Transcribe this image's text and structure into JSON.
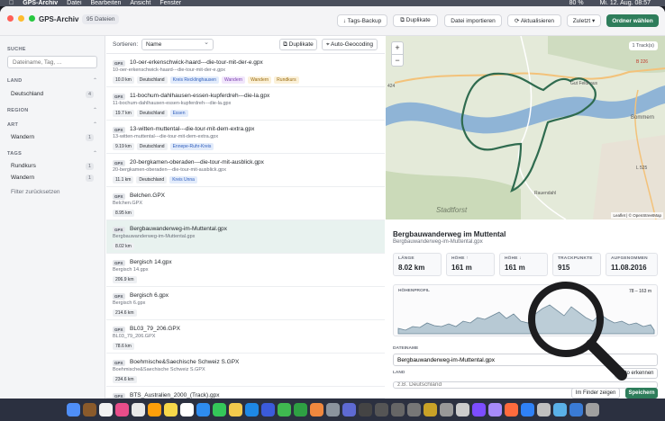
{
  "menubar": {
    "app": "GPS-Archiv",
    "items": [
      "Datei",
      "Bearbeiten",
      "Ansicht",
      "Fenster"
    ],
    "battery": "80 %",
    "datetime": "Mi. 12. Aug. 08:57"
  },
  "titlebar": {
    "title": "GPS-Archiv",
    "count": "95 Dateien",
    "buttons": {
      "tags_backup": "↓ Tags-Backup",
      "duplicates": "⧉ Duplikate",
      "import": "Datei importieren",
      "refresh": "⟳ Aktualisieren",
      "recent": "Zuletzt ▾",
      "choose_folder": "Ordner wählen"
    }
  },
  "sidebar": {
    "search_head": "SUCHE",
    "search_placeholder": "Dateiname, Tag, ...",
    "land_head": "LAND",
    "land_items": [
      {
        "label": "Deutschland",
        "count": "4"
      }
    ],
    "region_head": "REGION",
    "art_head": "ART",
    "art_items": [
      {
        "label": "Wandern",
        "count": "1"
      }
    ],
    "tags_head": "TAGS",
    "tag_items": [
      {
        "label": "Rundkurs",
        "count": "1"
      },
      {
        "label": "Wandern",
        "count": "1"
      }
    ],
    "reset": "Filter zurücksetzen"
  },
  "list": {
    "sort_label": "Sortieren:",
    "sort_value": "Name",
    "duplicates_btn": "⧉ Duplikate",
    "geocode_btn": "⌖ Auto-Geocoding",
    "gpx_badge": "GPX",
    "rows": [
      {
        "title": "10-oer-erkenschwick-haard---die-tour-mit-der-e.gpx",
        "sub": "10-oer-erkenschwick-haard---die-tour-mit-der-e.gpx",
        "tags": [
          "10.0 km",
          "Deutschland",
          "Kreis Recklinghausen",
          "Wandern",
          "Wandern",
          "Rundkurs"
        ]
      },
      {
        "title": "11-bochum-dahlhausen-essen-kupferdreh---die-la.gpx",
        "sub": "11-bochum-dahlhausen-essen-kupferdreh---die-la.gpx",
        "tags": [
          "19.7 km",
          "Deutschland",
          "Essen"
        ]
      },
      {
        "title": "13-witten-muttental---die-tour-mit-dem-extra.gpx",
        "sub": "13-witten-muttental---die-tour-mit-dem-extra.gpx",
        "tags": [
          "9.19 km",
          "Deutschland",
          "Ennepe-Ruhr-Kreis"
        ]
      },
      {
        "title": "20-bergkamen-oberaden---die-tour-mit-ausblick.gpx",
        "sub": "20-bergkamen-oberaden---die-tour-mit-ausblick.gpx",
        "tags": [
          "11.1 km",
          "Deutschland",
          "Kreis Unna"
        ]
      },
      {
        "title": "Belchen.GPX",
        "sub": "Belchen.GPX",
        "tags": [
          "8.95 km"
        ]
      },
      {
        "title": "Bergbauwanderweg-im-Muttental.gpx",
        "sub": "Bergbauwanderweg-im-Muttental.gpx",
        "tags": [
          "8.02 km"
        ]
      },
      {
        "title": "Bergisch 14.gpx",
        "sub": "Bergisch 14.gpx",
        "tags": [
          "206.9 km"
        ]
      },
      {
        "title": "Bergisch 6.gpx",
        "sub": "Bergisch 6.gpx",
        "tags": [
          "214.6 km"
        ]
      },
      {
        "title": "BL03_79_206.GPX",
        "sub": "BL03_79_206.GPX",
        "tags": [
          "78.6 km"
        ]
      },
      {
        "title": "Boehmische&Saechische Schweiz S.GPX",
        "sub": "Boehmische&Saechische Schweiz S.GPX",
        "tags": [
          "234.6 km"
        ]
      },
      {
        "title": "BTS_Australien_2000_(Track).gpx",
        "sub": "",
        "tags": []
      }
    ]
  },
  "map": {
    "zoom_in": "+",
    "zoom_out": "−",
    "track_count": "1 Track(s)",
    "attribution": "Leaflet | © OpenStreetMap",
    "labels": [
      "Stadtforst",
      "Bommern",
      "Rauendahl",
      "Gut Feldhaus",
      "Witten"
    ],
    "road_labels": [
      "B 226",
      "L 525",
      "424"
    ]
  },
  "detail": {
    "title": "Bergbauwanderweg im Muttental",
    "subtitle": "Bergbauwanderweg-im-Muttental.gpx",
    "stats": [
      {
        "label": "LÄNGE",
        "value": "8.02 km"
      },
      {
        "label": "HÖHE ↑",
        "value": "161 m"
      },
      {
        "label": "HÖHE ↓",
        "value": "161 m"
      },
      {
        "label": "TRACKPUNKTE",
        "value": "915"
      },
      {
        "label": "AUFGENOMMEN",
        "value": "11.08.2016"
      }
    ],
    "profile_label": "HÖHENPROFIL",
    "profile_range": "78 – 163 m",
    "filename_label": "DATEINAME",
    "filename_value": "Bergbauwanderweg-im-Muttental.gpx",
    "land_label": "LAND",
    "land_value": "z.B. Deutschland",
    "auto_detect": "Auto erkennen",
    "show_in_finder": "Im Finder zeigen",
    "save": "Speichern"
  },
  "colors": {
    "accent": "#2e7d5b",
    "track": "#2f6b4f",
    "water": "#8fb4d6"
  }
}
